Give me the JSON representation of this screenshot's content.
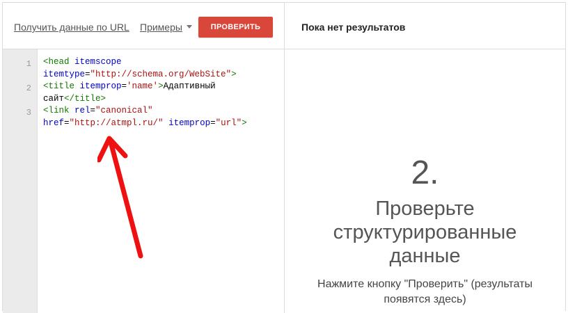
{
  "toolbar": {
    "fetch_url_label": "Получить данные по URL",
    "examples_label": "Примеры",
    "check_button_label": "ПРОВЕРИТЬ"
  },
  "results": {
    "header_title": "Пока нет результатов",
    "step_number": "2.",
    "step_title_lines": [
      "Проверьте",
      "структурированные",
      "данные"
    ],
    "step_note_lines": [
      "Нажмите кнопку \"Проверить\" (результаты",
      "появятся здесь)"
    ]
  },
  "editor": {
    "line_numbers": [
      "1",
      "2",
      "3"
    ],
    "code_rows": [
      [
        {
          "t": "tag",
          "v": "<head "
        },
        {
          "t": "attr",
          "v": "itemscope"
        }
      ],
      [
        {
          "t": "attr",
          "v": "itemtype"
        },
        {
          "t": "txt",
          "v": "="
        },
        {
          "t": "str",
          "v": "\"http://schema.org/WebSite\""
        },
        {
          "t": "tag",
          "v": ">"
        }
      ],
      [
        {
          "t": "tag",
          "v": "<title "
        },
        {
          "t": "attr",
          "v": "itemprop"
        },
        {
          "t": "txt",
          "v": "="
        },
        {
          "t": "str",
          "v": "'name'"
        },
        {
          "t": "tag",
          "v": ">"
        },
        {
          "t": "txt",
          "v": "Адаптивный"
        }
      ],
      [
        {
          "t": "txt",
          "v": "сайт"
        },
        {
          "t": "tag",
          "v": "</title>"
        }
      ],
      [
        {
          "t": "tag",
          "v": "<link "
        },
        {
          "t": "attr",
          "v": "rel"
        },
        {
          "t": "txt",
          "v": "="
        },
        {
          "t": "str",
          "v": "\"canonical\""
        }
      ],
      [
        {
          "t": "attr",
          "v": "href"
        },
        {
          "t": "txt",
          "v": "="
        },
        {
          "t": "str",
          "v": "\"http://atmpl.ru/\""
        },
        {
          "t": "txt",
          "v": " "
        },
        {
          "t": "attr",
          "v": "itemprop"
        },
        {
          "t": "txt",
          "v": "="
        },
        {
          "t": "str",
          "v": "\"url\""
        },
        {
          "t": "tag",
          "v": ">"
        }
      ]
    ]
  },
  "colors": {
    "check_button": "#d9463a",
    "arrow": "#ee1111",
    "code_tag": "#117700",
    "code_attr": "#0000cc",
    "code_string": "#aa1111"
  },
  "icons": {
    "examples_dropdown": "caret-down-icon",
    "annotation": "red-arrow-icon"
  }
}
